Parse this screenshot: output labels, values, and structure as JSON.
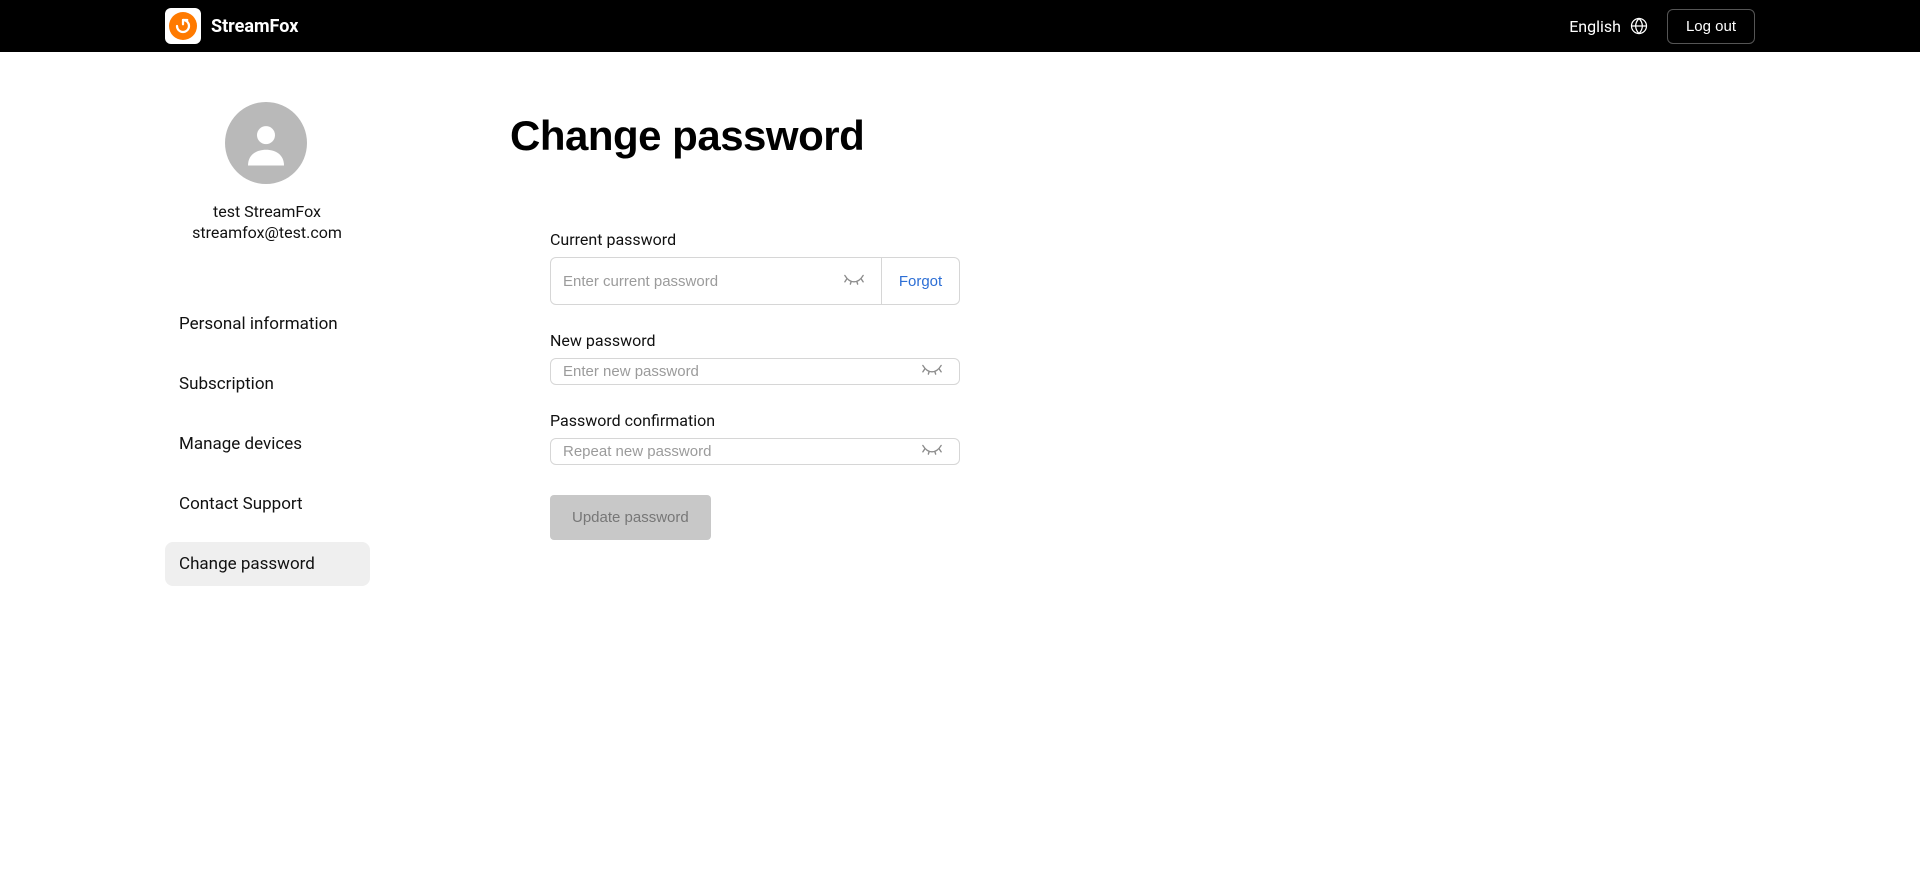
{
  "brand": {
    "name": "StreamFox"
  },
  "header": {
    "language": "English",
    "logout": "Log out"
  },
  "user": {
    "name": "test StreamFox",
    "email": "streamfox@test.com"
  },
  "nav": {
    "personal": "Personal information",
    "subscription": "Subscription",
    "devices": "Manage devices",
    "support": "Contact Support",
    "password": "Change password"
  },
  "page": {
    "title": "Change password"
  },
  "form": {
    "current_label": "Current password",
    "current_placeholder": "Enter current password",
    "forgot": "Forgot",
    "new_label": "New password",
    "new_placeholder": "Enter new password",
    "confirm_label": "Password confirmation",
    "confirm_placeholder": "Repeat new password",
    "submit": "Update password"
  }
}
